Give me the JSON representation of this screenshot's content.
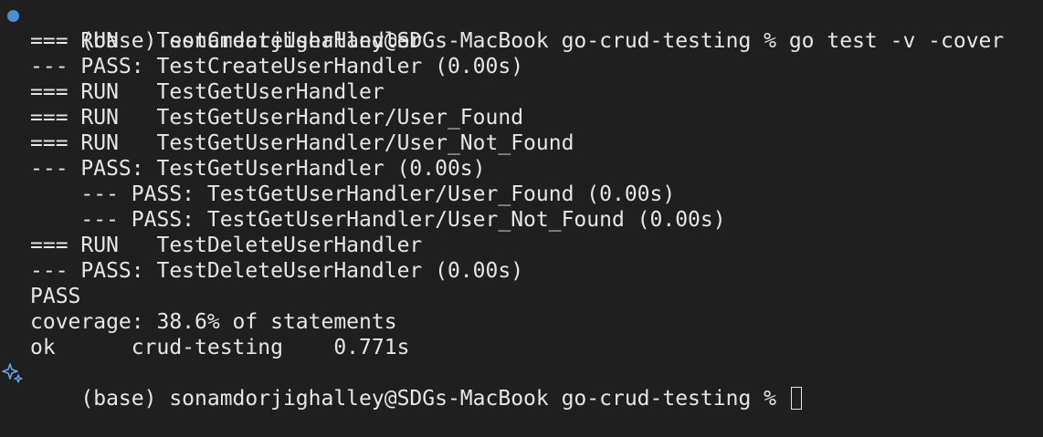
{
  "prompt_command": {
    "text": "(base) sonamdorjighalley@SDGs-MacBook go-crud-testing % go test -v -cover",
    "status_color": "#4a90d9",
    "marker_icon": "blue-dot-icon"
  },
  "output_lines": [
    "=== RUN   TestCreateUserHandler",
    "--- PASS: TestCreateUserHandler (0.00s)",
    "=== RUN   TestGetUserHandler",
    "=== RUN   TestGetUserHandler/User_Found",
    "=== RUN   TestGetUserHandler/User_Not_Found",
    "--- PASS: TestGetUserHandler (0.00s)",
    "    --- PASS: TestGetUserHandler/User_Found (0.00s)",
    "    --- PASS: TestGetUserHandler/User_Not_Found (0.00s)",
    "=== RUN   TestDeleteUserHandler",
    "--- PASS: TestDeleteUserHandler (0.00s)",
    "PASS",
    "coverage: 38.6% of statements",
    "ok      crud-testing    0.771s"
  ],
  "prompt_current": {
    "text": "(base) sonamdorjighalley@SDGs-MacBook go-crud-testing % ",
    "marker_icon": "sparkle-icon",
    "sparkle_color": "#6aa6e8"
  }
}
